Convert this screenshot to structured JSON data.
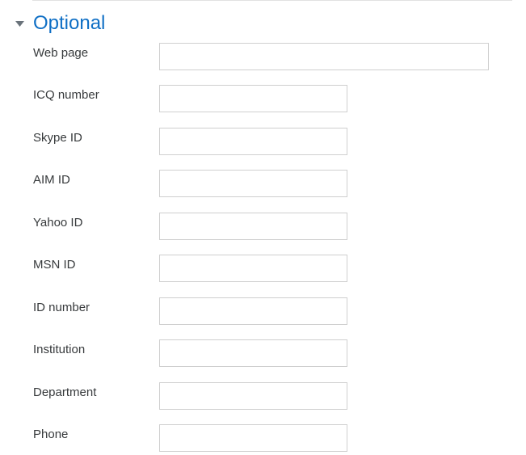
{
  "section": {
    "title": "Optional",
    "expanded": true,
    "title_color": "#0f6fc5"
  },
  "fields": {
    "web_page": {
      "label": "Web page",
      "value": ""
    },
    "icq_number": {
      "label": "ICQ number",
      "value": ""
    },
    "skype_id": {
      "label": "Skype ID",
      "value": ""
    },
    "aim_id": {
      "label": "AIM ID",
      "value": ""
    },
    "yahoo_id": {
      "label": "Yahoo ID",
      "value": ""
    },
    "msn_id": {
      "label": "MSN ID",
      "value": ""
    },
    "id_number": {
      "label": "ID number",
      "value": ""
    },
    "institution": {
      "label": "Institution",
      "value": ""
    },
    "department": {
      "label": "Department",
      "value": ""
    },
    "phone": {
      "label": "Phone",
      "value": ""
    }
  },
  "icons": {
    "toggle": "caret-down-icon"
  }
}
